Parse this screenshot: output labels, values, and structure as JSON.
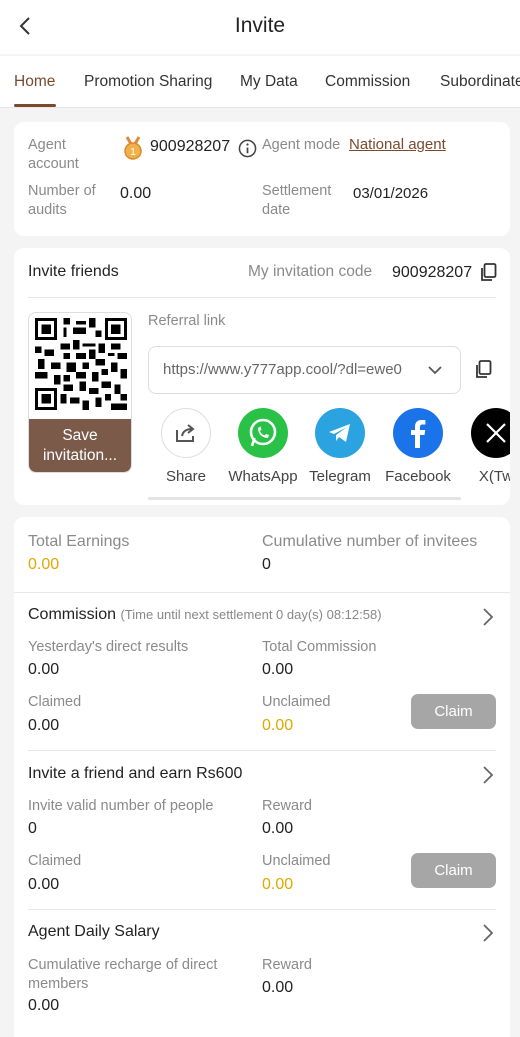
{
  "header": {
    "title": "Invite"
  },
  "tabs": [
    {
      "label": "Home"
    },
    {
      "label": "Promotion Sharing"
    },
    {
      "label": "My Data"
    },
    {
      "label": "Commission"
    },
    {
      "label": "Subordinate"
    }
  ],
  "agent": {
    "account_label": "Agent account",
    "account_value": "900928207",
    "mode_label": "Agent mode",
    "mode_value": "National agent",
    "audits_label": "Number of audits",
    "audits_value": "0.00",
    "settlement_label": "Settlement date",
    "settlement_value": "03/01/2026"
  },
  "invite": {
    "title": "Invite friends",
    "code_label": "My invitation code",
    "code_value": "900928207",
    "save_label": "Save invitation...",
    "referral_label": "Referral link",
    "referral_url": "https://www.y777app.cool/?dl=ewe0",
    "share_items": [
      {
        "label": "Share",
        "color": "#ffffff"
      },
      {
        "label": "WhatsApp",
        "color": "#29c146"
      },
      {
        "label": "Telegram",
        "color": "#2aa3e0"
      },
      {
        "label": "Facebook",
        "color": "#1a73e8"
      },
      {
        "label": "X(Tw",
        "color": "#000000"
      }
    ]
  },
  "earnings": {
    "total_label": "Total Earnings",
    "total_value": "0.00",
    "invitees_label": "Cumulative number of invitees",
    "invitees_value": "0"
  },
  "commission": {
    "title": "Commission",
    "timer": "(Time until next settlement 0 day(s) 08:12:58)",
    "yesterday_label": "Yesterday's direct results",
    "yesterday_value": "0.00",
    "total_label": "Total Commission",
    "total_value": "0.00",
    "claimed_label": "Claimed",
    "claimed_value": "0.00",
    "unclaimed_label": "Unclaimed",
    "unclaimed_value": "0.00",
    "claim_label": "Claim"
  },
  "friend_reward": {
    "title": "Invite a friend and earn Rs600",
    "valid_label": "Invite valid number of people",
    "valid_value": "0",
    "reward_label": "Reward",
    "reward_value": "0.00",
    "claimed_label": "Claimed",
    "claimed_value": "0.00",
    "unclaimed_label": "Unclaimed",
    "unclaimed_value": "0.00",
    "claim_label": "Claim"
  },
  "salary": {
    "title": "Agent Daily Salary",
    "recharge_label": "Cumulative recharge of direct members",
    "recharge_value": "0.00",
    "reward_label": "Reward",
    "reward_value": "0.00"
  },
  "colors": {
    "accent": "#7b4a2e",
    "gold": "#e0a800",
    "claim_disabled": "#a6a6a6"
  }
}
